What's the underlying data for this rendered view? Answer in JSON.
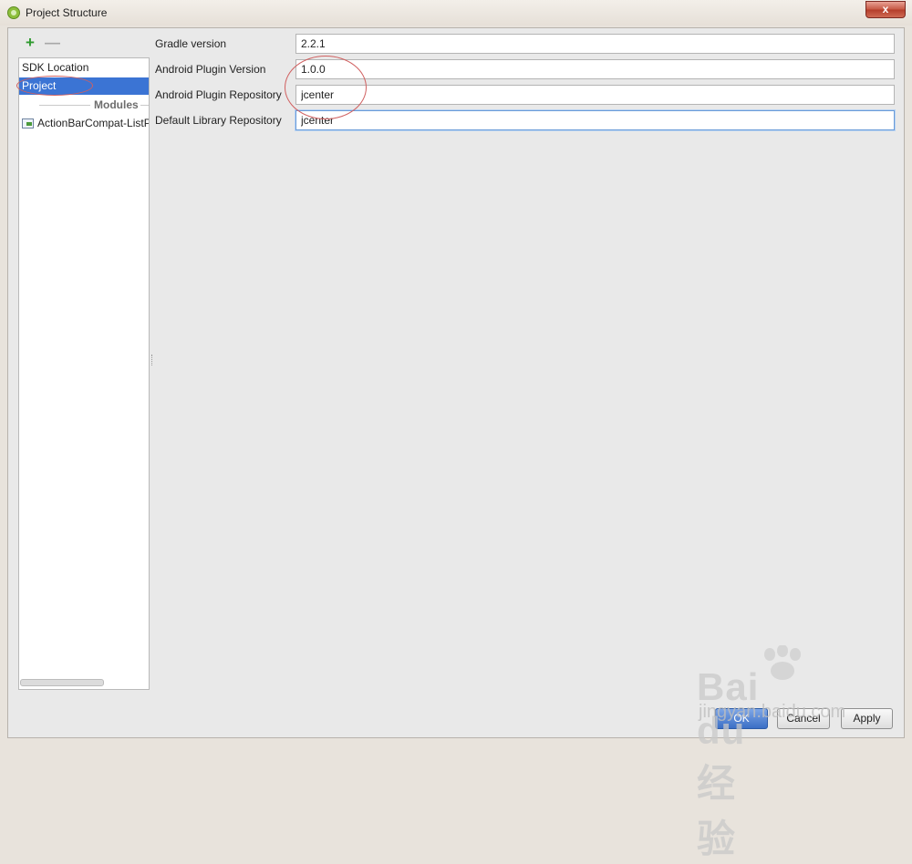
{
  "window": {
    "title": "Project Structure",
    "close_label": "x"
  },
  "toolbar": {
    "add_label": "+",
    "remove_label": "—"
  },
  "sidebar": {
    "items": [
      {
        "label": "SDK Location"
      },
      {
        "label": "Project"
      }
    ],
    "selected": "Project",
    "modules_header": "Modules",
    "modules": [
      {
        "label": "ActionBarCompat-ListPopupMenu"
      }
    ]
  },
  "form": {
    "fields": [
      {
        "label": "Gradle version",
        "value": "2.2.1"
      },
      {
        "label": "Android Plugin Version",
        "value": "1.0.0"
      },
      {
        "label": "Android Plugin Repository",
        "value": "jcenter"
      },
      {
        "label": "Default Library Repository",
        "value": "jcenter"
      }
    ]
  },
  "buttons": {
    "ok": "OK",
    "cancel": "Cancel",
    "apply": "Apply"
  },
  "watermark": {
    "brand": "Bai du 经验",
    "url": "jingyan.baidu.com"
  },
  "colors": {
    "selection": "#3b74d4",
    "annotation": "#d06060",
    "add": "#2e9a2e"
  }
}
